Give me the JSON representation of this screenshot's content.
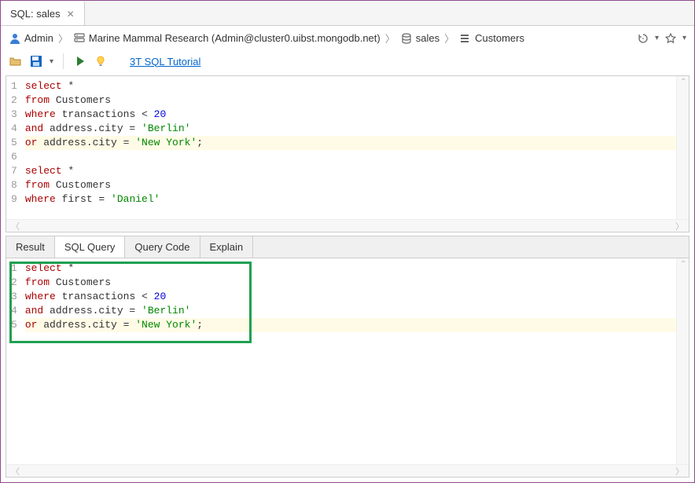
{
  "tab": {
    "title": "SQL: sales"
  },
  "breadcrumb": {
    "user": "Admin",
    "connection": "Marine Mammal Research (Admin@cluster0.uibst.mongodb.net)",
    "database": "sales",
    "collection": "Customers"
  },
  "toolbar": {
    "tutorial_link": "3T SQL Tutorial"
  },
  "editor": {
    "lines": [
      {
        "n": 1,
        "tokens": [
          {
            "t": "select",
            "c": "kw"
          },
          {
            "t": " *",
            "c": ""
          }
        ]
      },
      {
        "n": 2,
        "tokens": [
          {
            "t": "from",
            "c": "kw"
          },
          {
            "t": " Customers",
            "c": ""
          }
        ]
      },
      {
        "n": 3,
        "tokens": [
          {
            "t": "where",
            "c": "kw"
          },
          {
            "t": " transactions < ",
            "c": ""
          },
          {
            "t": "20",
            "c": "num"
          }
        ]
      },
      {
        "n": 4,
        "tokens": [
          {
            "t": "and",
            "c": "kw"
          },
          {
            "t": " address.city = ",
            "c": ""
          },
          {
            "t": "'Berlin'",
            "c": "str"
          }
        ]
      },
      {
        "n": 5,
        "tokens": [
          {
            "t": "or",
            "c": "kw"
          },
          {
            "t": " address.city = ",
            "c": ""
          },
          {
            "t": "'New York'",
            "c": "str"
          },
          {
            "t": ";",
            "c": "op"
          }
        ],
        "highlight": true
      },
      {
        "n": 6,
        "tokens": []
      },
      {
        "n": 7,
        "tokens": [
          {
            "t": "select",
            "c": "kw"
          },
          {
            "t": " *",
            "c": ""
          }
        ]
      },
      {
        "n": 8,
        "tokens": [
          {
            "t": "from",
            "c": "kw"
          },
          {
            "t": " Customers",
            "c": ""
          }
        ]
      },
      {
        "n": 9,
        "tokens": [
          {
            "t": "where",
            "c": "kw"
          },
          {
            "t": " first = ",
            "c": ""
          },
          {
            "t": "'Daniel'",
            "c": "str"
          }
        ]
      }
    ]
  },
  "result_tabs": {
    "items": [
      "Result",
      "SQL Query",
      "Query Code",
      "Explain"
    ],
    "active": 1
  },
  "result_editor": {
    "lines": [
      {
        "n": 1,
        "tokens": [
          {
            "t": "select",
            "c": "kw"
          },
          {
            "t": " *",
            "c": ""
          }
        ]
      },
      {
        "n": 2,
        "tokens": [
          {
            "t": "from",
            "c": "kw"
          },
          {
            "t": " Customers",
            "c": ""
          }
        ]
      },
      {
        "n": 3,
        "tokens": [
          {
            "t": "where",
            "c": "kw"
          },
          {
            "t": " transactions < ",
            "c": ""
          },
          {
            "t": "20",
            "c": "num"
          }
        ]
      },
      {
        "n": 4,
        "tokens": [
          {
            "t": "and",
            "c": "kw"
          },
          {
            "t": " address.city = ",
            "c": ""
          },
          {
            "t": "'Berlin'",
            "c": "str"
          }
        ]
      },
      {
        "n": 5,
        "tokens": [
          {
            "t": "or",
            "c": "kw"
          },
          {
            "t": " address.city = ",
            "c": ""
          },
          {
            "t": "'New York'",
            "c": "str"
          },
          {
            "t": ";",
            "c": "op"
          }
        ],
        "highlight": true
      }
    ]
  }
}
